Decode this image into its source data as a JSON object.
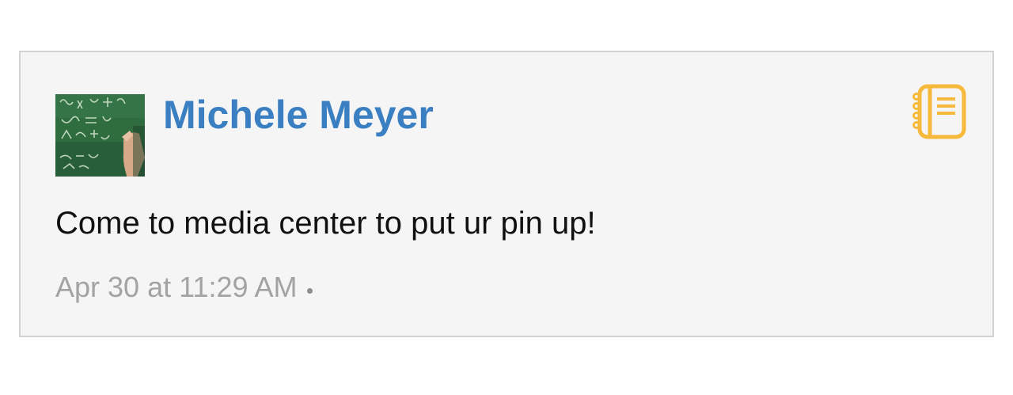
{
  "post": {
    "author": "Michele Meyer",
    "message": "Come to media center to put ur pin up!",
    "timestamp": "Apr 30 at 11:29 AM",
    "type_icon": "notebook-icon",
    "colors": {
      "author": "#3a7fc1",
      "type_icon": "#f6b93b",
      "card_background": "#f5f5f5",
      "timestamp": "#a3a3a3"
    }
  }
}
